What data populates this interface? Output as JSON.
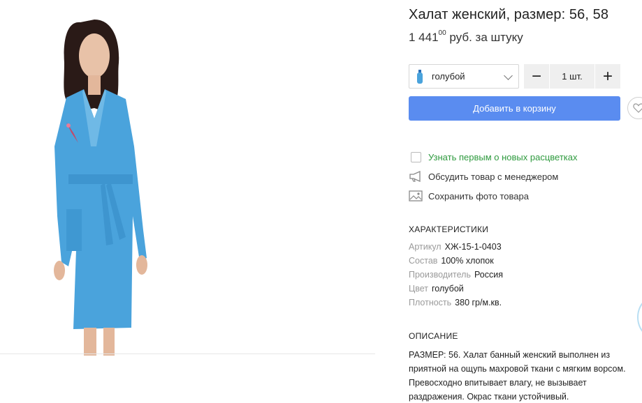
{
  "product": {
    "title": "Халат женский, размер: 56, 58",
    "price_main": "1 441",
    "price_cents": "00",
    "price_unit": "руб. за штуку"
  },
  "color_select": {
    "value": "голубой",
    "icon": "bottle-icon"
  },
  "quantity": {
    "minus": "−",
    "value": "1 шт.",
    "plus": "+"
  },
  "add_to_cart": "Добавить в корзину",
  "options": [
    {
      "label": "Узнать первым о новых расцветках",
      "icon": "checkbox"
    },
    {
      "label": "Обсудить товар с менеджером",
      "icon": "megaphone-icon"
    },
    {
      "label": "Сохранить фото товара",
      "icon": "image-icon"
    }
  ],
  "characteristics": {
    "title": "ХАРАКТЕРИСТИКИ",
    "items": [
      {
        "key": "Артикул",
        "value": "ХЖ-15-1-0403"
      },
      {
        "key": "Состав",
        "value": "100% хлопок"
      },
      {
        "key": "Производитель",
        "value": "Россия"
      },
      {
        "key": "Цвет",
        "value": "голубой"
      },
      {
        "key": "Плотность",
        "value": "380 гр/м.кв."
      }
    ]
  },
  "description": {
    "title": "ОПИСАНИЕ",
    "text": "РАЗМЕР: 56. Халат банный женский выполнен из приятной на ощупь махровой ткани с мягким ворсом. Превосходно впитывает влагу, не вызывает раздражения. Окрас ткани устойчивый."
  },
  "colors": {
    "accent": "#5a8cf0",
    "green": "#2e9a3e",
    "robe": "#4aa3dc"
  }
}
